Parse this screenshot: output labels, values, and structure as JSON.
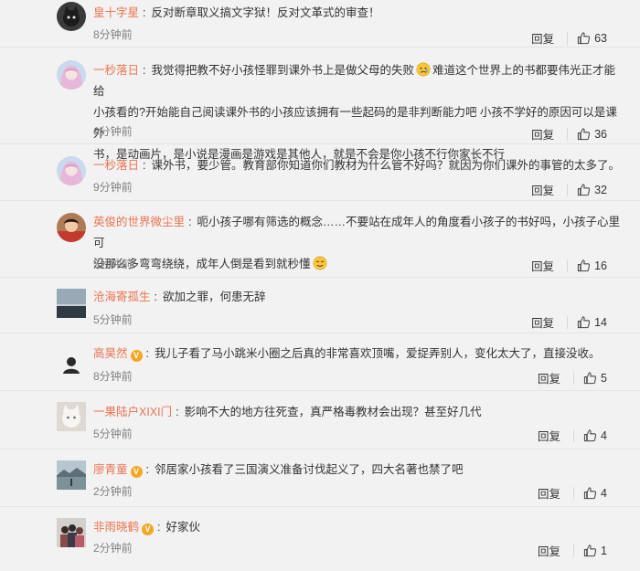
{
  "comments": [
    {
      "username": "皇十字星",
      "verified": false,
      "text": "反对断章取义搞文字狱！反对文革式的审查！",
      "time": "8分钟前",
      "reply_label": "回复",
      "likes": "63",
      "avatar_icon": "avatar-dark-cat"
    },
    {
      "username": "一秒落日",
      "verified": false,
      "text_line1_a": "我觉得把教不好小孩怪罪到课外书上是做父母的失败",
      "text_line1_b": "难道这个世界上的书都要伟光正才能给",
      "text_line2": "小孩看的?开始能自己阅读课外书的小孩应该拥有一些起码的是非判断能力吧 小孩不学好的原因可以是课外",
      "text_line3": "书，是动画片，是小说是漫画是游戏是其他人，就是不会是你小孩不行你家长不行",
      "time": "6分钟前",
      "reply_label": "回复",
      "likes": "36",
      "avatar_icon": "avatar-anime-girl"
    },
    {
      "username": "一秒落日",
      "verified": false,
      "text": "课外书，要少管。教育部你知道你们教材为什么管不好吗？就因为你们课外的事管的太多了。",
      "time": "9分钟前",
      "reply_label": "回复",
      "likes": "32",
      "avatar_icon": "avatar-anime-girl"
    },
    {
      "username": "英俊的世界微尘里",
      "verified": false,
      "text_line1": "呃小孩子哪有筛选的概念……不要站在成年人的角度看小孩子的书好吗，小孩子心里可",
      "text_line2": "没那么多弯弯绕绕，成年人倒是看到就秒懂",
      "time": "5分钟前",
      "reply_label": "回复",
      "likes": "16",
      "avatar_icon": "avatar-child-photo"
    },
    {
      "username": "沧海寄孤生",
      "verified": false,
      "text": "欲加之罪，何患无辞",
      "time": "5分钟前",
      "reply_label": "回复",
      "likes": "14",
      "avatar_icon": "avatar-seascape"
    },
    {
      "username": "高昊然",
      "verified": true,
      "text": "我儿子看了马小跳米小圈之后真的非常喜欢顶嘴，爱捉弄别人，变化太大了，直接没收。",
      "time": "8分钟前",
      "reply_label": "回复",
      "likes": "5",
      "avatar_icon": "avatar-person-silhouette"
    },
    {
      "username": "一果陆户XIXI门",
      "verified": false,
      "text": "影响不大的地方往死查，真严格毒教材会出现？甚至好几代",
      "time": "5分钟前",
      "reply_label": "回复",
      "likes": "4",
      "avatar_icon": "avatar-white-cat"
    },
    {
      "username": "廖青童",
      "verified": true,
      "text": "邻居家小孩看了三国演义准备讨伐起义了，四大名著也禁了吧",
      "time": "2分钟前",
      "reply_label": "回复",
      "likes": "4",
      "avatar_icon": "avatar-lake-landscape"
    },
    {
      "username": "非雨晓鹤",
      "verified": true,
      "text": "好家伙",
      "time": "2分钟前",
      "reply_label": "回复",
      "likes": "1",
      "avatar_icon": "avatar-group-photo"
    }
  ],
  "colors": {
    "username": "#eb7350",
    "background": "#f2f2f2",
    "verified_badge": "#f5a623"
  }
}
